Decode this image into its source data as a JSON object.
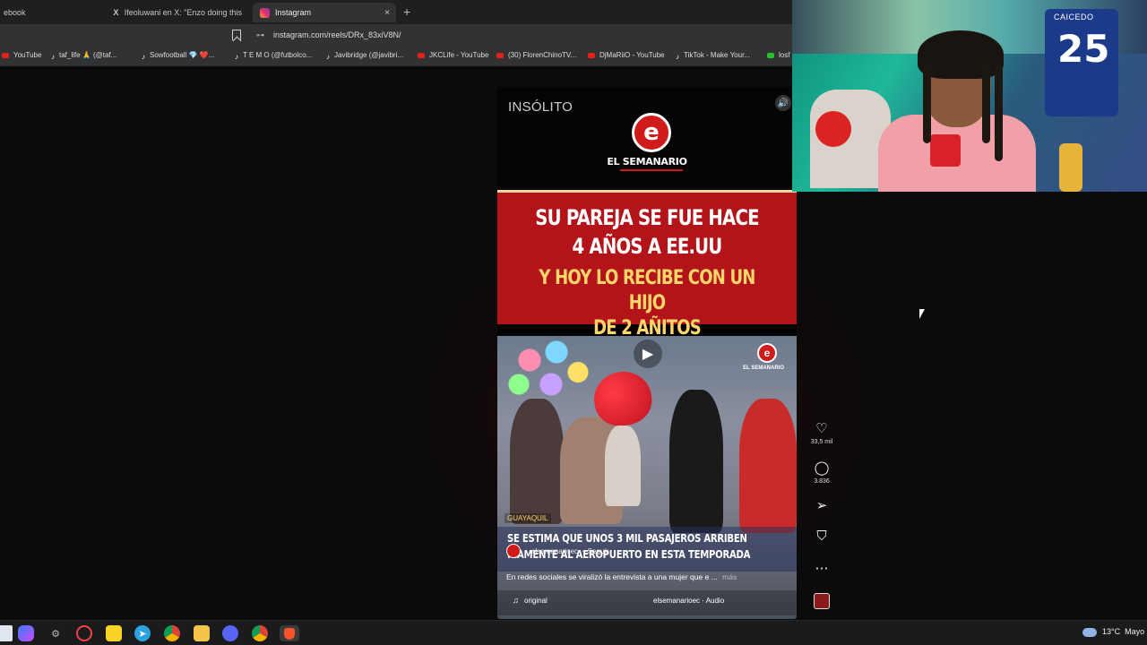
{
  "tabs": [
    {
      "title": "ebook",
      "icon": "facebook-icon"
    },
    {
      "title": "Ifeoluwani en X: \"Enzo doing this",
      "icon": "x-icon"
    },
    {
      "title": "Instagram",
      "icon": "instagram-icon",
      "active": true
    }
  ],
  "tab_close": "×",
  "new_tab": "+",
  "address": {
    "url": "instagram.com/reels/DRx_83xiV8N/",
    "site_icon": "⊶"
  },
  "bookmarks": [
    {
      "label": "YouTube",
      "icon": "youtube-icon"
    },
    {
      "label": "taf_life 🙏 (@taf...",
      "icon": "tiktok-icon"
    },
    {
      "label": "Sowfootball 💎 ❤️...",
      "icon": "tiktok-icon"
    },
    {
      "label": "T E M O (@futbolco...",
      "icon": "tiktok-icon"
    },
    {
      "label": "Javibridge (@javibri...",
      "icon": "tiktok-icon"
    },
    {
      "label": "JKCLife - YouTube",
      "icon": "youtube-icon"
    },
    {
      "label": "(30) FlorenChinoTV...",
      "icon": "youtube-icon"
    },
    {
      "label": "DjMaRiiO - YouTube",
      "icon": "youtube-icon"
    },
    {
      "label": "TikTok - Make Your...",
      "icon": "tiktok-icon"
    },
    {
      "label": "losf",
      "icon": "kick-icon"
    }
  ],
  "reel": {
    "tag": "INSÓLITO",
    "logo_letter": "e",
    "logo_text": "EL SEMANARIO",
    "headline_1": "SU PAREJA SE FUE HACE",
    "headline_2": "4 AÑOS A EE.UU",
    "headline_3": "Y HOY LO RECIBE CON UN HIJO",
    "headline_4": "DE 2 AÑITOS",
    "video_logo_text": "EL SEMANARIO",
    "location": "GUAYAQUIL",
    "ticker_1": "SE ESTIMA QUE UNOS 3 MIL PASAJEROS ARRIBEN",
    "ticker_2": "RIAMENTE AL AEROPUERTO EN ESTA TEMPORADA",
    "account": "elsemanarioec",
    "follow": "Seguir",
    "caption": "En redes sociales se viralizó la entrevista a una mujer que e ...",
    "more": "más",
    "audio_label": "original",
    "audio_source": "elsemanarioec · Audio"
  },
  "actions": {
    "likes": "33,5 mil",
    "comments": "3.836"
  },
  "webcam": {
    "jersey_name": "CAICEDO",
    "jersey_number": "25"
  },
  "taskbar": {
    "apps": [
      "start-icon",
      "copilot-icon",
      "settings-icon",
      "browser-icon",
      "sticky-notes-icon",
      "telegram-icon",
      "chrome-icon",
      "file-explorer-icon",
      "discord-icon",
      "chrome-icon",
      "brave-icon"
    ],
    "temperature": "13°C",
    "weather_text": "Mayo"
  }
}
